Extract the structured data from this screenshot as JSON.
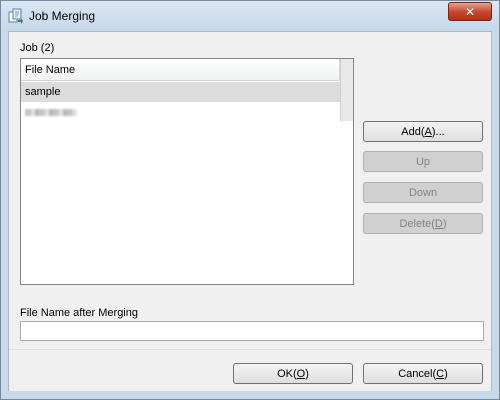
{
  "window": {
    "title": "Job Merging",
    "close_symbol": "✕"
  },
  "job_group": {
    "label": "Job (2)",
    "column_header": "File Name",
    "rows": [
      {
        "name": "sample",
        "selected": true
      },
      {
        "name": "",
        "redacted": true,
        "selected": false
      }
    ]
  },
  "side_buttons": {
    "add": {
      "prefix": "Add(",
      "key": "A",
      "suffix": ")..."
    },
    "up": "Up",
    "down": "Down",
    "delete": {
      "prefix": "Delete(",
      "key": "D",
      "suffix": ")"
    }
  },
  "merge_name": {
    "label": "File Name after Merging",
    "value": ""
  },
  "footer_buttons": {
    "ok": {
      "prefix": "OK(",
      "key": "O",
      "suffix": ")"
    },
    "cancel": {
      "prefix": "Cancel(",
      "key": "C",
      "suffix": ")"
    }
  },
  "icons": {
    "app": "job-merging-icon",
    "close": "close-icon"
  },
  "colors": {
    "frame": "#c9d9ec",
    "close_button": "#c7432b",
    "selected_row": "#dcdcdc",
    "disabled_button": "#d0d0d0"
  }
}
